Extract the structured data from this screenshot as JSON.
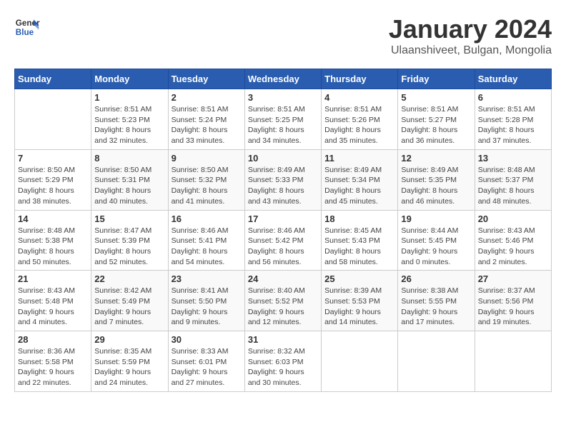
{
  "header": {
    "logo_line1": "General",
    "logo_line2": "Blue",
    "title": "January 2024",
    "subtitle": "Ulaanshiveet, Bulgan, Mongolia"
  },
  "days_of_week": [
    "Sunday",
    "Monday",
    "Tuesday",
    "Wednesday",
    "Thursday",
    "Friday",
    "Saturday"
  ],
  "weeks": [
    [
      {
        "day": "",
        "info": ""
      },
      {
        "day": "1",
        "info": "Sunrise: 8:51 AM\nSunset: 5:23 PM\nDaylight: 8 hours\nand 32 minutes."
      },
      {
        "day": "2",
        "info": "Sunrise: 8:51 AM\nSunset: 5:24 PM\nDaylight: 8 hours\nand 33 minutes."
      },
      {
        "day": "3",
        "info": "Sunrise: 8:51 AM\nSunset: 5:25 PM\nDaylight: 8 hours\nand 34 minutes."
      },
      {
        "day": "4",
        "info": "Sunrise: 8:51 AM\nSunset: 5:26 PM\nDaylight: 8 hours\nand 35 minutes."
      },
      {
        "day": "5",
        "info": "Sunrise: 8:51 AM\nSunset: 5:27 PM\nDaylight: 8 hours\nand 36 minutes."
      },
      {
        "day": "6",
        "info": "Sunrise: 8:51 AM\nSunset: 5:28 PM\nDaylight: 8 hours\nand 37 minutes."
      }
    ],
    [
      {
        "day": "7",
        "info": "Sunrise: 8:50 AM\nSunset: 5:29 PM\nDaylight: 8 hours\nand 38 minutes."
      },
      {
        "day": "8",
        "info": "Sunrise: 8:50 AM\nSunset: 5:31 PM\nDaylight: 8 hours\nand 40 minutes."
      },
      {
        "day": "9",
        "info": "Sunrise: 8:50 AM\nSunset: 5:32 PM\nDaylight: 8 hours\nand 41 minutes."
      },
      {
        "day": "10",
        "info": "Sunrise: 8:49 AM\nSunset: 5:33 PM\nDaylight: 8 hours\nand 43 minutes."
      },
      {
        "day": "11",
        "info": "Sunrise: 8:49 AM\nSunset: 5:34 PM\nDaylight: 8 hours\nand 45 minutes."
      },
      {
        "day": "12",
        "info": "Sunrise: 8:49 AM\nSunset: 5:35 PM\nDaylight: 8 hours\nand 46 minutes."
      },
      {
        "day": "13",
        "info": "Sunrise: 8:48 AM\nSunset: 5:37 PM\nDaylight: 8 hours\nand 48 minutes."
      }
    ],
    [
      {
        "day": "14",
        "info": "Sunrise: 8:48 AM\nSunset: 5:38 PM\nDaylight: 8 hours\nand 50 minutes."
      },
      {
        "day": "15",
        "info": "Sunrise: 8:47 AM\nSunset: 5:39 PM\nDaylight: 8 hours\nand 52 minutes."
      },
      {
        "day": "16",
        "info": "Sunrise: 8:46 AM\nSunset: 5:41 PM\nDaylight: 8 hours\nand 54 minutes."
      },
      {
        "day": "17",
        "info": "Sunrise: 8:46 AM\nSunset: 5:42 PM\nDaylight: 8 hours\nand 56 minutes."
      },
      {
        "day": "18",
        "info": "Sunrise: 8:45 AM\nSunset: 5:43 PM\nDaylight: 8 hours\nand 58 minutes."
      },
      {
        "day": "19",
        "info": "Sunrise: 8:44 AM\nSunset: 5:45 PM\nDaylight: 9 hours\nand 0 minutes."
      },
      {
        "day": "20",
        "info": "Sunrise: 8:43 AM\nSunset: 5:46 PM\nDaylight: 9 hours\nand 2 minutes."
      }
    ],
    [
      {
        "day": "21",
        "info": "Sunrise: 8:43 AM\nSunset: 5:48 PM\nDaylight: 9 hours\nand 4 minutes."
      },
      {
        "day": "22",
        "info": "Sunrise: 8:42 AM\nSunset: 5:49 PM\nDaylight: 9 hours\nand 7 minutes."
      },
      {
        "day": "23",
        "info": "Sunrise: 8:41 AM\nSunset: 5:50 PM\nDaylight: 9 hours\nand 9 minutes."
      },
      {
        "day": "24",
        "info": "Sunrise: 8:40 AM\nSunset: 5:52 PM\nDaylight: 9 hours\nand 12 minutes."
      },
      {
        "day": "25",
        "info": "Sunrise: 8:39 AM\nSunset: 5:53 PM\nDaylight: 9 hours\nand 14 minutes."
      },
      {
        "day": "26",
        "info": "Sunrise: 8:38 AM\nSunset: 5:55 PM\nDaylight: 9 hours\nand 17 minutes."
      },
      {
        "day": "27",
        "info": "Sunrise: 8:37 AM\nSunset: 5:56 PM\nDaylight: 9 hours\nand 19 minutes."
      }
    ],
    [
      {
        "day": "28",
        "info": "Sunrise: 8:36 AM\nSunset: 5:58 PM\nDaylight: 9 hours\nand 22 minutes."
      },
      {
        "day": "29",
        "info": "Sunrise: 8:35 AM\nSunset: 5:59 PM\nDaylight: 9 hours\nand 24 minutes."
      },
      {
        "day": "30",
        "info": "Sunrise: 8:33 AM\nSunset: 6:01 PM\nDaylight: 9 hours\nand 27 minutes."
      },
      {
        "day": "31",
        "info": "Sunrise: 8:32 AM\nSunset: 6:03 PM\nDaylight: 9 hours\nand 30 minutes."
      },
      {
        "day": "",
        "info": ""
      },
      {
        "day": "",
        "info": ""
      },
      {
        "day": "",
        "info": ""
      }
    ]
  ]
}
